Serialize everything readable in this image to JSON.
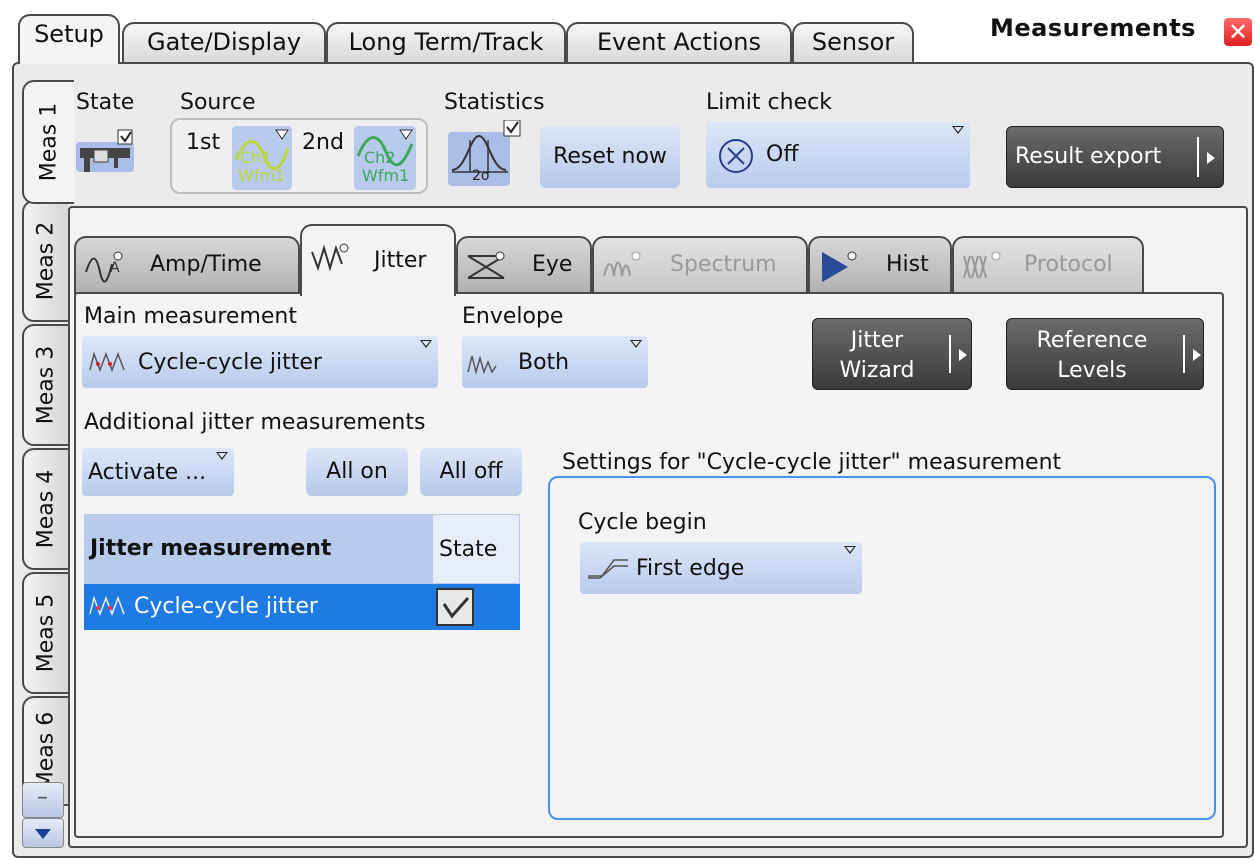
{
  "window": {
    "title": "Measurements",
    "close_icon": "close-icon",
    "close_glyph": "✕"
  },
  "top_tabs": [
    {
      "label": "Setup",
      "active": true
    },
    {
      "label": "Gate/Display",
      "active": false
    },
    {
      "label": "Long Term/Track",
      "active": false
    },
    {
      "label": "Event Actions",
      "active": false
    },
    {
      "label": "Sensor",
      "active": false
    }
  ],
  "side_tabs": [
    {
      "label": "Meas 1",
      "active": true
    },
    {
      "label": "Meas 2",
      "active": false
    },
    {
      "label": "Meas 3",
      "active": false
    },
    {
      "label": "Meas 4",
      "active": false
    },
    {
      "label": "Meas 5",
      "active": false
    },
    {
      "label": "Meas 6",
      "active": false
    }
  ],
  "header": {
    "state_label": "State",
    "state_checked": true,
    "source_label": "Source",
    "source_1st_label": "1st",
    "source_1st_value": {
      "line1": "Ch1",
      "line2": "Wfm1"
    },
    "source_2nd_label": "2nd",
    "source_2nd_value": {
      "line1": "Ch2",
      "line2": "Wfm1"
    },
    "statistics_label": "Statistics",
    "statistics_checked": true,
    "statistics_sigma": "2σ",
    "reset_now_label": "Reset now",
    "limit_check_label": "Limit check",
    "limit_check_value": "Off",
    "result_export_label": "Result export"
  },
  "sub_tabs": [
    {
      "label": "Amp/Time",
      "active": false,
      "disabled": false
    },
    {
      "label": "Jitter",
      "active": true,
      "disabled": false
    },
    {
      "label": "Eye",
      "active": false,
      "disabled": false
    },
    {
      "label": "Spectrum",
      "active": false,
      "disabled": true
    },
    {
      "label": "Hist",
      "active": false,
      "disabled": false
    },
    {
      "label": "Protocol",
      "active": false,
      "disabled": true
    }
  ],
  "jitter": {
    "main_measurement_label": "Main measurement",
    "main_measurement_value": "Cycle-cycle jitter",
    "envelope_label": "Envelope",
    "envelope_value": "Both",
    "jitter_wizard_line1": "Jitter",
    "jitter_wizard_line2": "Wizard",
    "reference_levels_line1": "Reference",
    "reference_levels_line2": "Levels",
    "additional_label": "Additional jitter measurements",
    "activate_label": "Activate ...",
    "all_on_label": "All on",
    "all_off_label": "All off",
    "table": {
      "col_measurement": "Jitter measurement",
      "col_state": "State",
      "rows": [
        {
          "measurement": "Cycle-cycle jitter",
          "state": true,
          "selected": true
        }
      ]
    },
    "settings_title": "Settings for \"Cycle-cycle jitter\" measurement",
    "cycle_begin_label": "Cycle begin",
    "cycle_begin_value": "First edge"
  },
  "scroll": {
    "minus_glyph": "–"
  },
  "colors": {
    "accent_blue": "#1e7be3",
    "combo_blue": "#b9cbed",
    "dark_button": "#3a3a3a",
    "close_red": "#e02020",
    "focus_border": "#4a90e8",
    "ch1_green": "#b8d83c",
    "ch2_green": "#3ca85a"
  }
}
